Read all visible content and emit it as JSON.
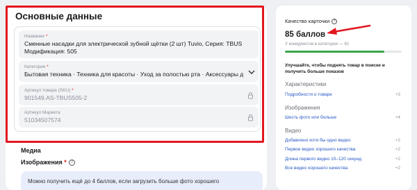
{
  "main": {
    "section_title": "Основные данные",
    "fields": [
      {
        "label": "Название",
        "required": "*",
        "value": "Сменные насадки для электрической зубной щётки (2 шт) Tuvio, Серия: TBUS Модификация: 505"
      },
      {
        "label": "Категория",
        "required": "*",
        "value": "Бытовая техника · Техника для красоты · Уход за полостью рта · Аксессуары для ..."
      },
      {
        "label": "Артикул товара (SKU)",
        "required": "*",
        "value": "901549.AS-TBUS505-2"
      },
      {
        "label": "Артикул Маркета",
        "required": "",
        "value": "51034507574"
      }
    ],
    "media_title": "Медиа",
    "images_title": "Изображения",
    "images_required": "*",
    "help_glyph": "?",
    "hint": "Можно получить ещё до 4 баллов, если загрузить больше фото хорошего"
  },
  "quality": {
    "title": "Качество карточки",
    "help_glyph": "?",
    "score": "85 баллов",
    "competitors": "У конкурентов в категории — 61",
    "progress_fraction": 0.85,
    "advice": "Улучшайте, чтобы поднять товар в поиске и получить больше показов",
    "groups": [
      {
        "title": "Характеристики",
        "items": [
          {
            "label": "Подробности о товаре",
            "points": "+3"
          }
        ]
      },
      {
        "title": "Изображения",
        "items": [
          {
            "label": "Шесть фото или больше",
            "points": "+4"
          }
        ]
      },
      {
        "title": "Видео",
        "items": [
          {
            "label": "Добавлено хотя бы одно видео",
            "points": "+2"
          },
          {
            "label": "Первое видео хорошего качества",
            "points": "+2"
          },
          {
            "label": "Длина первого видео 10–120 секунд",
            "points": "+2"
          },
          {
            "label": "Все видео хорошего качества",
            "points": "+2"
          }
        ]
      }
    ]
  },
  "icons": [
    "lock-icon",
    "chevron-down-icon",
    "help-icon",
    "annotation-arrow"
  ],
  "colors": {
    "accent_red": "#e3161e",
    "link_blue": "#2556c4",
    "progress_green": "#3aa54a",
    "hint_bg": "#e8edfb"
  }
}
